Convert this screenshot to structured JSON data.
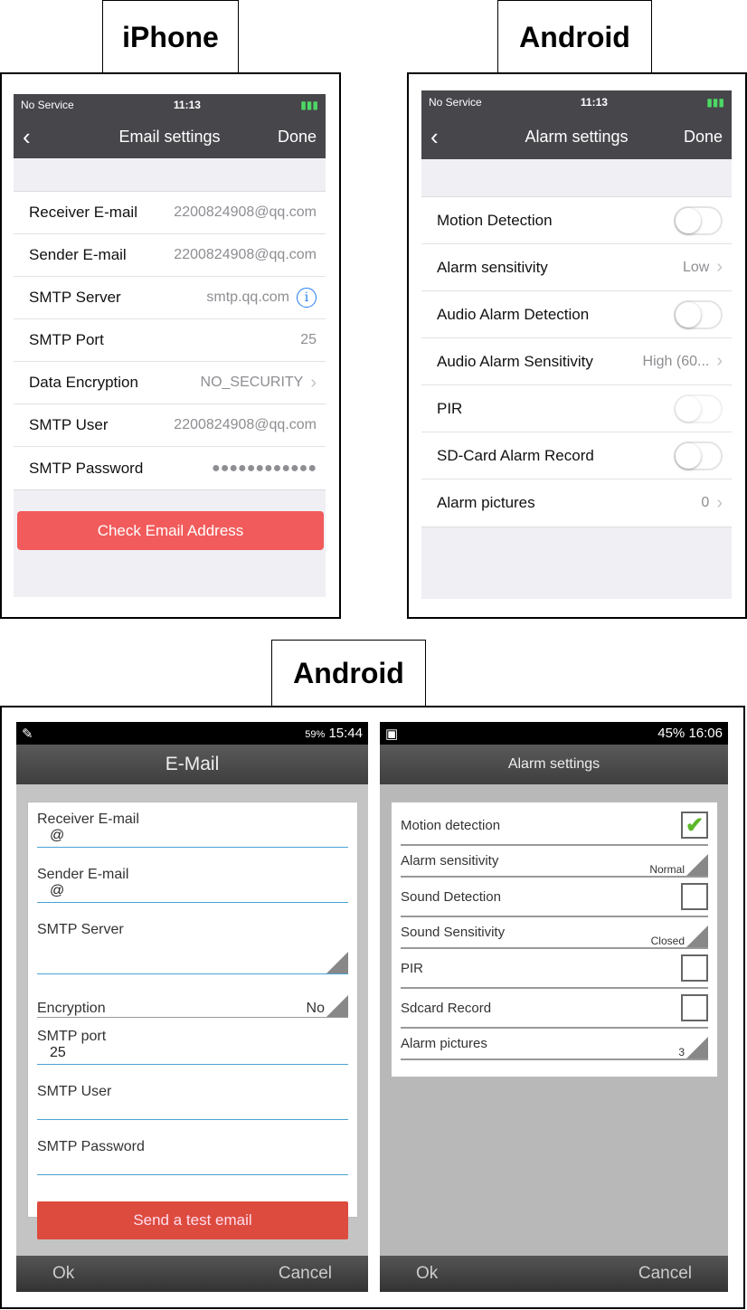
{
  "labels": {
    "iphone": "iPhone",
    "android1": "Android",
    "android2": "Android"
  },
  "ios_email": {
    "status": {
      "carrier": "No Service",
      "time": "11:13"
    },
    "title": "Email settings",
    "done": "Done",
    "rows": [
      {
        "label": "Receiver E-mail",
        "value": "2200824908@qq.com"
      },
      {
        "label": "Sender E-mail",
        "value": "2200824908@qq.com"
      },
      {
        "label": "SMTP Server",
        "value": "smtp.qq.com",
        "icon": "info-icon"
      },
      {
        "label": "SMTP Port",
        "value": "25"
      },
      {
        "label": "Data Encryption",
        "value": "NO_SECURITY",
        "icon": "chevron-right-icon"
      },
      {
        "label": "SMTP User",
        "value": "2200824908@qq.com"
      },
      {
        "label": "SMTP Password",
        "value": "●●●●●●●●●●●●"
      }
    ],
    "button": "Check Email Address",
    "accent": "#f25b5b"
  },
  "ios_alarm": {
    "status": {
      "carrier": "No Service",
      "time": "11:13"
    },
    "title": "Alarm settings",
    "done": "Done",
    "rows": [
      {
        "label": "Motion Detection",
        "toggle": false
      },
      {
        "label": "Alarm sensitivity",
        "value": "Low"
      },
      {
        "label": "Audio Alarm Detection",
        "toggle": false
      },
      {
        "label": "Audio Alarm Sensitivity",
        "value": "High (60..."
      },
      {
        "label": "PIR",
        "toggle": false
      },
      {
        "label": "SD-Card Alarm Record",
        "toggle": false
      },
      {
        "label": "Alarm pictures",
        "value": "0"
      }
    ]
  },
  "and_email": {
    "status": {
      "battery": "59%",
      "time": "15:44"
    },
    "title": "E-Mail",
    "fields": [
      {
        "label": "Receiver E-mail",
        "value": "@"
      },
      {
        "label": "Sender E-mail",
        "value": "@"
      },
      {
        "label": "SMTP Server",
        "value": ""
      },
      {
        "label": "Encryption",
        "value": "No"
      },
      {
        "label": "SMTP port",
        "value": "25"
      },
      {
        "label": "SMTP User",
        "value": ""
      },
      {
        "label": "SMTP Password",
        "value": ""
      }
    ],
    "button": "Send a test email",
    "ok": "Ok",
    "cancel": "Cancel",
    "accent": "#dd4b3e"
  },
  "and_alarm": {
    "status": {
      "battery": "45%",
      "time": "16:06"
    },
    "title": "Alarm settings",
    "rows": [
      {
        "label": "Motion detection",
        "checked": true
      },
      {
        "label": "Alarm sensitivity",
        "value": "Normal"
      },
      {
        "label": "Sound Detection",
        "checked": false
      },
      {
        "label": "Sound Sensitivity",
        "value": "Closed"
      },
      {
        "label": "PIR",
        "checked": false
      },
      {
        "label": "Sdcard Record",
        "checked": false
      },
      {
        "label": "Alarm pictures",
        "value": "3"
      }
    ],
    "ok": "Ok",
    "cancel": "Cancel"
  }
}
